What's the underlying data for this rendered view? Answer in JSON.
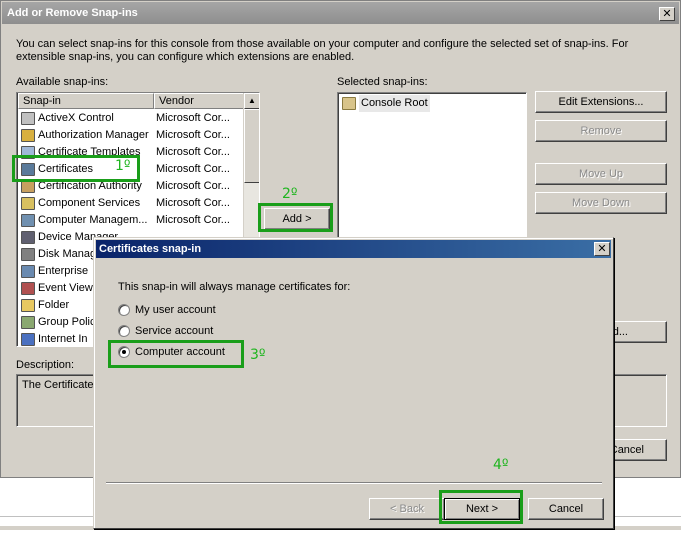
{
  "main": {
    "title": "Add or Remove Snap-ins",
    "description_line1": "You can select snap-ins for this console from those available on your computer and configure the selected set of snap-ins. For",
    "description_line2": "extensible snap-ins, you can configure which extensions are enabled.",
    "available_label": "Available snap-ins:",
    "selected_label": "Selected snap-ins:",
    "columns": [
      "Snap-in",
      "Vendor"
    ],
    "available_items": [
      {
        "name": "ActiveX Control",
        "vendor": "Microsoft Cor...",
        "icon": "activex-icon"
      },
      {
        "name": "Authorization Manager",
        "vendor": "Microsoft Cor...",
        "icon": "authorization-icon"
      },
      {
        "name": "Certificate Templates",
        "vendor": "Microsoft Cor...",
        "icon": "certificate-templates-icon"
      },
      {
        "name": "Certificates",
        "vendor": "Microsoft Cor...",
        "icon": "certificates-icon"
      },
      {
        "name": "Certification Authority",
        "vendor": "Microsoft Cor...",
        "icon": "certification-authority-icon"
      },
      {
        "name": "Component Services",
        "vendor": "Microsoft Cor...",
        "icon": "component-services-icon"
      },
      {
        "name": "Computer Managem...",
        "vendor": "Microsoft Cor...",
        "icon": "computer-management-icon"
      },
      {
        "name": "Device Manager",
        "vendor": "",
        "icon": "device-manager-icon"
      },
      {
        "name": "Disk Manag",
        "vendor": "",
        "icon": "disk-management-icon"
      },
      {
        "name": "Enterprise",
        "vendor": "",
        "icon": "enterprise-icon"
      },
      {
        "name": "Event View",
        "vendor": "",
        "icon": "event-viewer-icon"
      },
      {
        "name": "Folder",
        "vendor": "",
        "icon": "folder-icon"
      },
      {
        "name": "Group Polic",
        "vendor": "",
        "icon": "group-policy-icon"
      },
      {
        "name": "Internet In",
        "vendor": "",
        "icon": "internet-icon"
      }
    ],
    "selected_items": [
      {
        "name": "Console Root",
        "icon": "folder-icon"
      }
    ],
    "add_button": "Add >",
    "edit_extensions_button": "Edit Extensions...",
    "remove_button": "Remove",
    "move_up_button": "Move Up",
    "move_down_button": "Move Down",
    "advanced_button_partial": "d...",
    "description_label": "Description:",
    "description_text": "The Certificate",
    "cancel_partial": "Cancel"
  },
  "dialog": {
    "title": "Certificates snap-in",
    "prompt": "This snap-in will always manage certificates for:",
    "options": [
      "My user account",
      "Service account",
      "Computer account"
    ],
    "selected_option": "Computer account",
    "back_button": "< Back",
    "next_button": "Next >",
    "cancel_button": "Cancel"
  },
  "annotations": {
    "step1": "1º",
    "step2": "2º",
    "step3": "3º",
    "step4": "4º",
    "color": "#1a9e1a"
  }
}
